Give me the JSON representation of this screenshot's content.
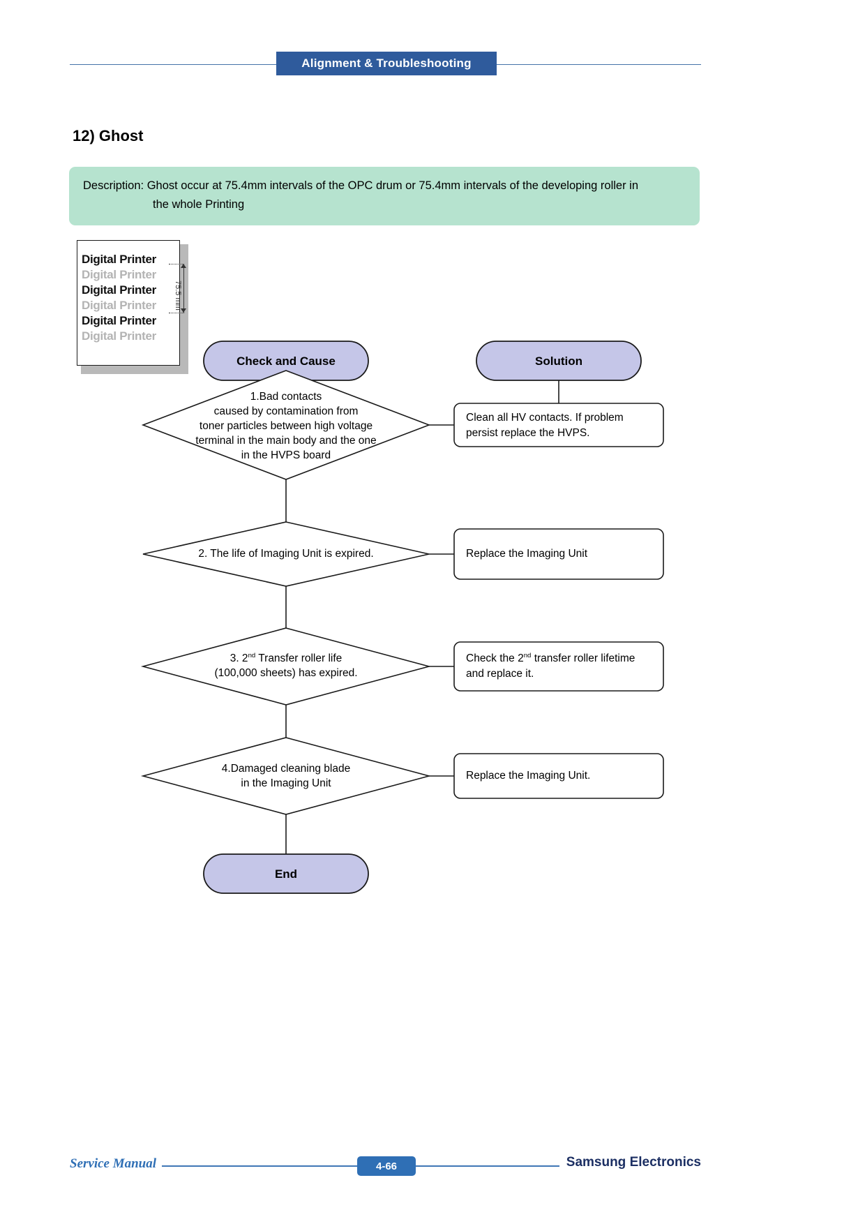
{
  "header": {
    "banner_title": "Alignment & Troubleshooting",
    "rule_color": "#4472a8",
    "banner_color": "#2f5b9c"
  },
  "section": {
    "title": "12) Ghost"
  },
  "description": {
    "background_color": "#b6e3cf",
    "line1": "Description: Ghost occur at 75.4mm intervals of the OPC drum or 75.4mm intervals of the developing roller in",
    "line2": "the whole Printing"
  },
  "sample_image": {
    "lines": [
      {
        "text": "Digital Printer",
        "tone": "dark"
      },
      {
        "text": "Digital Printer",
        "tone": "ghost"
      },
      {
        "text": "Digital Printer",
        "tone": "dark"
      },
      {
        "text": "Digital Printer",
        "tone": "ghost"
      },
      {
        "text": "Digital Printer",
        "tone": "dark"
      },
      {
        "text": "Digital Printer",
        "tone": "ghost"
      }
    ],
    "dimension_label": "75.5 mm"
  },
  "flowchart": {
    "node_fill": "#c5c6e8",
    "node_stroke": "#1a1a1a",
    "headers": {
      "check": "Check and Cause",
      "solution": "Solution"
    },
    "steps": [
      {
        "cause_lines": [
          "1.Bad contacts",
          "caused by contamination from",
          "toner particles between high voltage",
          "terminal in the main body and the one",
          "in the HVPS board"
        ],
        "solution_lines": [
          "Clean all HV contacts. If problem",
          "persist replace the HVPS."
        ]
      },
      {
        "cause_lines": [
          "2. The life of Imaging Unit is expired."
        ],
        "solution_lines": [
          "Replace the Imaging Unit"
        ]
      },
      {
        "cause_lines": [
          "3. 2nd Transfer roller life",
          "(100,000 sheets) has expired."
        ],
        "solution_lines": [
          "Check the 2nd transfer roller lifetime",
          " and replace it."
        ]
      },
      {
        "cause_lines": [
          "4.Damaged cleaning blade",
          "in the Imaging Unit"
        ],
        "solution_lines": [
          "Replace the Imaging Unit."
        ]
      }
    ],
    "end_label": "End"
  },
  "footer": {
    "left_text": "Service Manual",
    "page_number": "4-66",
    "right_text": "Samsung Electronics",
    "accent_color": "#2f6fb5"
  }
}
